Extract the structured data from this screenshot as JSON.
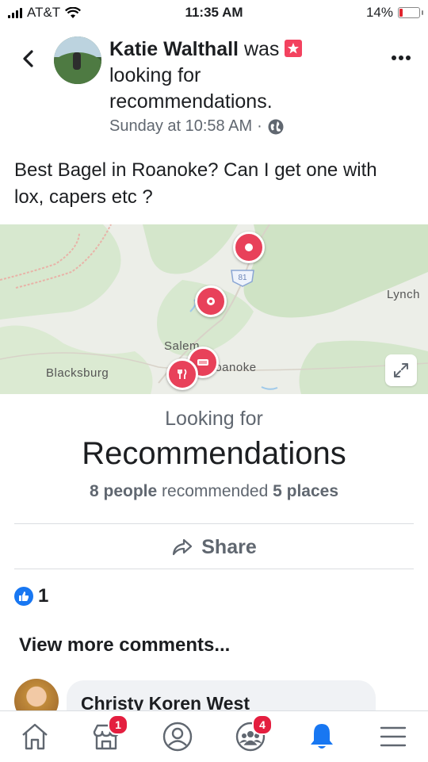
{
  "status": {
    "carrier": "AT&T",
    "time": "11:35 AM",
    "battery": "14%"
  },
  "post": {
    "author": "Katie Walthall",
    "action": "was",
    "action_rest": "looking for recommendations.",
    "timestamp": "Sunday at 10:58 AM",
    "separator": "·",
    "body": "Best Bagel in Roanoke? Can I get one with lox, capers etc ?"
  },
  "map": {
    "labels": {
      "lynch": "Lynch",
      "salem": "Salem",
      "roanoke": "Roanoke",
      "blacksburg": "Blacksburg",
      "highway": "81"
    },
    "pins": [
      "restaurant-pin",
      "restaurant-pin",
      "bagel-pin",
      "food-pin"
    ]
  },
  "recommendations": {
    "looking_for": "Looking for",
    "heading": "Recommendations",
    "people_count": "8 people",
    "recommended_text": "recommended",
    "places_count": "5 places"
  },
  "share": {
    "label": "Share"
  },
  "reactions": {
    "like_count": "1"
  },
  "comments": {
    "view_more": "View more comments...",
    "first_commenter": "Christy Koren West"
  },
  "tabbar": {
    "items": [
      "home-icon",
      "marketplace-icon",
      "profile-icon",
      "groups-icon",
      "notifications-icon",
      "menu-icon"
    ],
    "marketplace_badge": "1",
    "groups_badge": "4",
    "active_color": "#1877f2"
  }
}
